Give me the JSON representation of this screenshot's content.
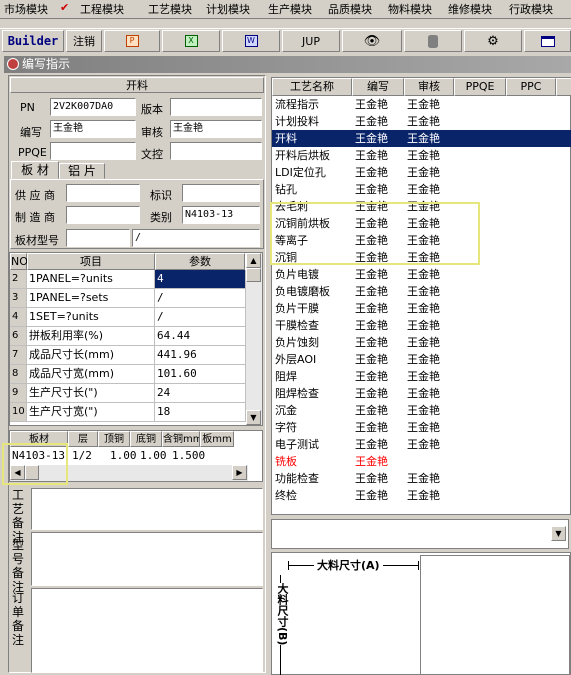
{
  "menu": [
    "市场模块",
    "工程模块",
    "工艺模块",
    "计划模块",
    "生产模块",
    "品质模块",
    "物料模块",
    "维修模块",
    "行政模块"
  ],
  "toolbar": {
    "builder": "Builder",
    "logout": "注销",
    "jup": "JUP"
  },
  "window_title": "编写指示",
  "left": {
    "section_title": "开料",
    "pn_label": "PN",
    "pn_value": "2V2K007DA0",
    "version_label": "版本",
    "version_value": "",
    "writer_label": "编写",
    "writer_value": "王金艳",
    "reviewer_label": "审核",
    "reviewer_value": "王金艳",
    "ppqe_label": "PPQE",
    "ppqe_value": "",
    "doc_label": "文控",
    "doc_value": "",
    "tabs": [
      "板 材",
      "铝 片"
    ],
    "supplier_label": "供 应 商",
    "mark_label": "标识",
    "maker_label": "制 造 商",
    "category_label": "类别",
    "category_value": "N4103-13",
    "board_model_label": "板材型号",
    "board_model_value": "/"
  },
  "param_table": {
    "headers": [
      "NO",
      "项目",
      "参数"
    ],
    "rows": [
      [
        "2",
        "1PANEL=?units",
        "4"
      ],
      [
        "3",
        "1PANEL=?sets",
        "/"
      ],
      [
        "4",
        "1SET=?units",
        "/"
      ],
      [
        "6",
        "拼板利用率(%)",
        "64.44"
      ],
      [
        "7",
        "成品尺寸长(mm)",
        "441.96"
      ],
      [
        "8",
        "成品尺寸宽(mm)",
        "101.60"
      ],
      [
        "9",
        "生产尺寸长(\")",
        "24"
      ],
      [
        "10",
        "生产尺寸宽(\")",
        "18"
      ]
    ]
  },
  "board_table": {
    "headers": [
      "板材",
      "层",
      "顶铜",
      "底铜",
      "含铜mm",
      "板mm"
    ],
    "row": [
      "N4103-13",
      "1/2",
      "1.00",
      "1.00",
      "1.500",
      ""
    ]
  },
  "notes": {
    "process_note": "工艺备注",
    "model_note": "型号备注",
    "order_note": "订单备注"
  },
  "process_table": {
    "headers": [
      "工艺名称",
      "编写",
      "审核",
      "PPQE",
      "PPC"
    ],
    "rows": [
      [
        "流程指示",
        "王金艳",
        "王金艳"
      ],
      [
        "计划投料",
        "王金艳",
        "王金艳"
      ],
      [
        "开料",
        "王金艳",
        "王金艳"
      ],
      [
        "开料后烘板",
        "王金艳",
        "王金艳"
      ],
      [
        "LDI定位孔",
        "王金艳",
        "王金艳"
      ],
      [
        "钻孔",
        "王金艳",
        "王金艳"
      ],
      [
        "去毛刺",
        "王金艳",
        "王金艳"
      ],
      [
        "沉铜前烘板",
        "王金艳",
        "王金艳"
      ],
      [
        "等离子",
        "王金艳",
        "王金艳"
      ],
      [
        "沉铜",
        "王金艳",
        "王金艳"
      ],
      [
        "负片电镀",
        "王金艳",
        "王金艳"
      ],
      [
        "负电镀磨板",
        "王金艳",
        "王金艳"
      ],
      [
        "负片干膜",
        "王金艳",
        "王金艳"
      ],
      [
        "干膜检查",
        "王金艳",
        "王金艳"
      ],
      [
        "负片蚀刻",
        "王金艳",
        "王金艳"
      ],
      [
        "外层AOI",
        "王金艳",
        "王金艳"
      ],
      [
        "阻焊",
        "王金艳",
        "王金艳"
      ],
      [
        "阻焊检查",
        "王金艳",
        "王金艳"
      ],
      [
        "沉金",
        "王金艳",
        "王金艳"
      ],
      [
        "字符",
        "王金艳",
        "王金艳"
      ],
      [
        "电子测试",
        "王金艳",
        "王金艳"
      ],
      [
        "铣板",
        "王金艳",
        ""
      ],
      [
        "功能检查",
        "王金艳",
        "王金艳"
      ],
      [
        "终检",
        "王金艳",
        "王金艳"
      ]
    ]
  },
  "diagram": {
    "width_label": "大料尺寸(A)",
    "height_label": "大料尺寸(B)"
  },
  "colors": {
    "selected": "#0a246a",
    "red": "#ff0000",
    "highlight": "#e6e67a"
  }
}
